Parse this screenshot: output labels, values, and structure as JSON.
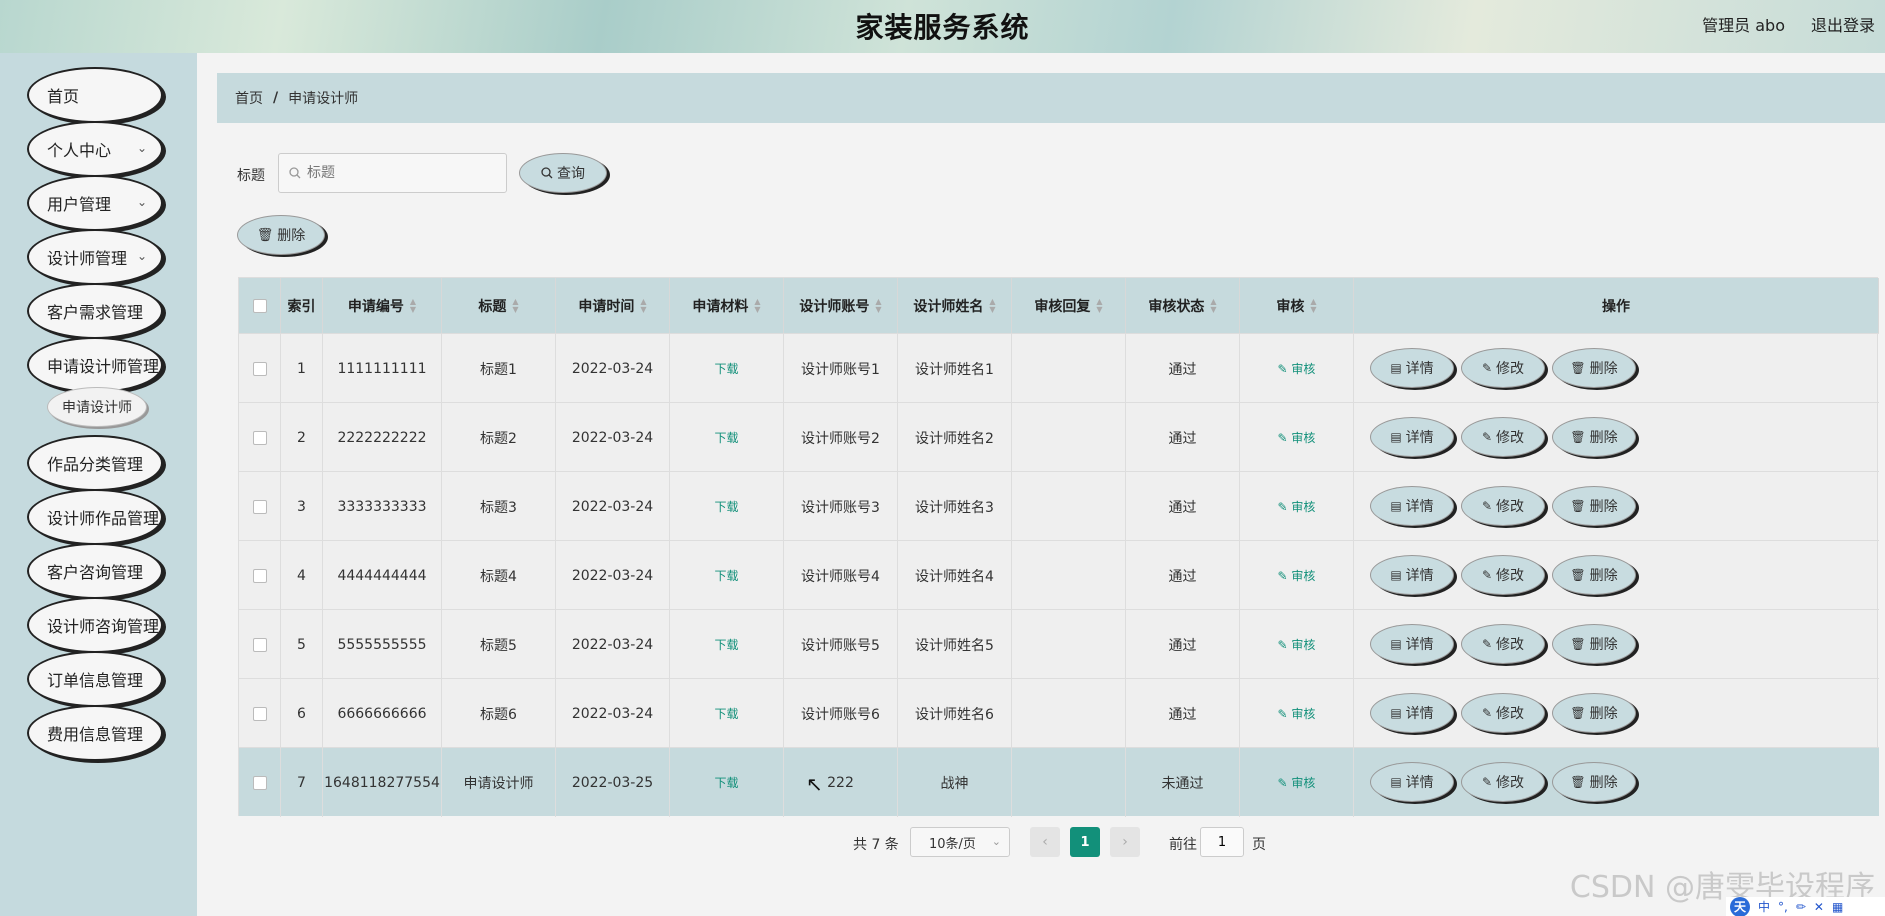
{
  "header": {
    "title": "家装服务系统",
    "admin": "管理员 abo",
    "logout": "退出登录"
  },
  "sidebar": {
    "items": [
      {
        "label": "首页",
        "has_arrow": false
      },
      {
        "label": "个人中心",
        "has_arrow": true
      },
      {
        "label": "用户管理",
        "has_arrow": true
      },
      {
        "label": "设计师管理",
        "has_arrow": true
      },
      {
        "label": "客户需求管理",
        "has_arrow": false
      },
      {
        "label": "申请设计师管理",
        "has_arrow": false
      },
      {
        "label": "作品分类管理",
        "has_arrow": false
      },
      {
        "label": "设计师作品管理",
        "has_arrow": false
      },
      {
        "label": "客户咨询管理",
        "has_arrow": false
      },
      {
        "label": "设计师咨询管理",
        "has_arrow": false
      },
      {
        "label": "订单信息管理",
        "has_arrow": false
      },
      {
        "label": "费用信息管理",
        "has_arrow": false
      }
    ],
    "sub_item": "申请设计师",
    "chevron": "chevron-down-icon"
  },
  "breadcrumb": {
    "home": "首页",
    "separator": "/",
    "current": "申请设计师"
  },
  "search": {
    "label": "标题",
    "placeholder": "标题",
    "button": "查询",
    "icon": "search-icon"
  },
  "toolbar": {
    "delete": "删除",
    "icon": "trash-icon"
  },
  "table": {
    "headers": [
      "索引",
      "申请编号",
      "标题",
      "申请时间",
      "申请材料",
      "设计师账号",
      "设计师姓名",
      "审核回复",
      "审核状态",
      "审核",
      "操作"
    ],
    "rows": [
      {
        "index": "1",
        "no": "1111111111",
        "title": "标题1",
        "date": "2022-03-24",
        "material": "下载",
        "account": "设计师账号1",
        "name": "设计师姓名1",
        "reply": "",
        "status": "通过",
        "audit": "审核"
      },
      {
        "index": "2",
        "no": "2222222222",
        "title": "标题2",
        "date": "2022-03-24",
        "material": "下载",
        "account": "设计师账号2",
        "name": "设计师姓名2",
        "reply": "",
        "status": "通过",
        "audit": "审核"
      },
      {
        "index": "3",
        "no": "3333333333",
        "title": "标题3",
        "date": "2022-03-24",
        "material": "下载",
        "account": "设计师账号3",
        "name": "设计师姓名3",
        "reply": "",
        "status": "通过",
        "audit": "审核"
      },
      {
        "index": "4",
        "no": "4444444444",
        "title": "标题4",
        "date": "2022-03-24",
        "material": "下载",
        "account": "设计师账号4",
        "name": "设计师姓名4",
        "reply": "",
        "status": "通过",
        "audit": "审核"
      },
      {
        "index": "5",
        "no": "5555555555",
        "title": "标题5",
        "date": "2022-03-24",
        "material": "下载",
        "account": "设计师账号5",
        "name": "设计师姓名5",
        "reply": "",
        "status": "通过",
        "audit": "审核"
      },
      {
        "index": "6",
        "no": "6666666666",
        "title": "标题6",
        "date": "2022-03-24",
        "material": "下载",
        "account": "设计师账号6",
        "name": "设计师姓名6",
        "reply": "",
        "status": "通过",
        "audit": "审核"
      },
      {
        "index": "7",
        "no": "1648118277554",
        "title": "申请设计师",
        "date": "2022-03-25",
        "material": "下载",
        "account": "222",
        "name": "战神",
        "reply": "",
        "status": "未通过",
        "audit": "审核"
      }
    ],
    "actions": {
      "detail": "详情",
      "edit": "修改",
      "delete": "删除"
    },
    "icons": {
      "detail": "document-icon",
      "edit": "pencil-icon",
      "delete": "trash-icon",
      "audit": "pencil-icon"
    },
    "colors": {
      "link": "#12907a",
      "header_bg": "#c6dadd",
      "highlight_row": "#c6dadd"
    }
  },
  "pagination": {
    "total": "共 7 条",
    "page_size": "10条/页",
    "current": "1",
    "goto": "前往",
    "goto_value": "1",
    "page_suffix": "页"
  },
  "watermark": "CSDN @唐雯毕设程序",
  "ime": {
    "logo": "天",
    "mode": "中"
  }
}
